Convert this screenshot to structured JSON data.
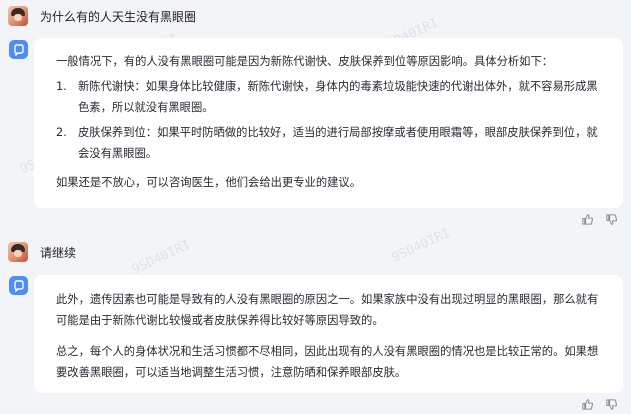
{
  "conversation": {
    "q1": "为什么有的人天生没有黑眼圈",
    "a1": {
      "intro": "一般情况下，有的人没有黑眼圈可能是因为新陈代谢快、皮肤保养到位等原因影响。具体分析如下：",
      "items": [
        {
          "num": "1.",
          "text": "新陈代谢快：如果身体比较健康，新陈代谢快，身体内的毒素垃圾能快速的代谢出体外，就不容易形成黑色素，所以就没有黑眼圈。"
        },
        {
          "num": "2.",
          "text": "皮肤保养到位：如果平时防晒做的比较好，适当的进行局部按摩或者使用眼霜等，眼部皮肤保养到位，就会没有黑眼圈。"
        }
      ],
      "outro": "如果还是不放心，可以咨询医生，他们会给出更专业的建议。"
    },
    "q2": "请继续",
    "a2": {
      "p1": "此外，遗传因素也可能是导致有的人没有黑眼圈的原因之一。如果家族中没有出现过明显的黑眼圈，那么就有可能是由于新陈代谢比较慢或者皮肤保养得比较好等原因导致的。",
      "p2": "总之，每个人的身体状况和生活习惯都不尽相同，因此出现有的人没有黑眼圈的情况也是比较正常的。如果想要改善黑眼圈，可以适当地调整生活习惯，注意防晒和保养眼部皮肤。"
    }
  },
  "watermark": "9SD40IRI",
  "icons": {
    "bot": "chat-bot-icon",
    "like": "thumbs-up-icon",
    "dislike": "thumbs-down-icon"
  },
  "colors": {
    "background": "#f3f4f8",
    "bubble": "#ffffff",
    "bot_accent": "#4d8df8"
  }
}
